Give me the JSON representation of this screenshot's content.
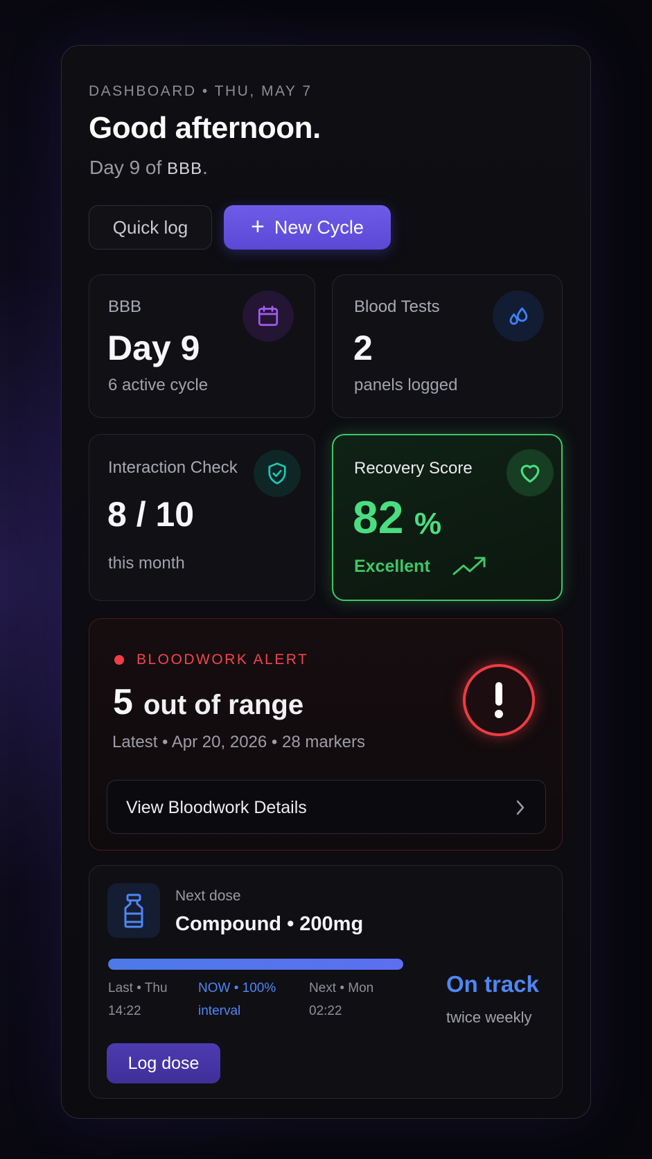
{
  "header": {
    "breadcrumb": "DASHBOARD • THU, MAY 7",
    "greeting": "Good afternoon.",
    "subtitle_prefix": "Day 9 of ",
    "subtitle_cycle": "BBB",
    "subtitle_suffix": "."
  },
  "actions": {
    "quick_log": "Quick log",
    "new_cycle_icon": "+",
    "new_cycle": "New Cycle"
  },
  "cards": {
    "cycle": {
      "label": "BBB",
      "value": "Day 9",
      "sub": "6 active cycle",
      "icon": "calendar-icon",
      "color": "#a45cf0"
    },
    "blood_tests": {
      "label": "Blood Tests",
      "value": "2",
      "sub": "panels logged",
      "icon": "droplets-icon",
      "color": "#3b82f6"
    },
    "interaction": {
      "label": "Interaction Check",
      "value": "8 / 10",
      "sub": "this month",
      "icon": "shield-check-icon",
      "color": "#22c5b2"
    },
    "recovery": {
      "label": "Recovery Score",
      "value": "82",
      "unit": "%",
      "sub": "Excellent",
      "icon": "heart-icon",
      "trend_icon": "trending-up-icon",
      "color": "#4ade80"
    }
  },
  "alert": {
    "eyebrow": "BLOODWORK ALERT",
    "count": "5",
    "count_text": "out of range",
    "meta": "Latest • Apr 20, 2026 • 28 markers",
    "details_button": "View Bloodwork Details",
    "color": "#f03e46"
  },
  "dose": {
    "label": "Next dose",
    "value": "Compound • 200mg",
    "progress": 1.0,
    "last_line1": "Last • Thu",
    "last_line2": "14:22",
    "now_line1": "NOW • 100%",
    "now_line2": "interval",
    "next_line1": "Next • Mon",
    "next_line2": "02:22",
    "status": "On track",
    "frequency": "twice weekly",
    "log_button": "Log dose",
    "color": "#4f86f2"
  }
}
